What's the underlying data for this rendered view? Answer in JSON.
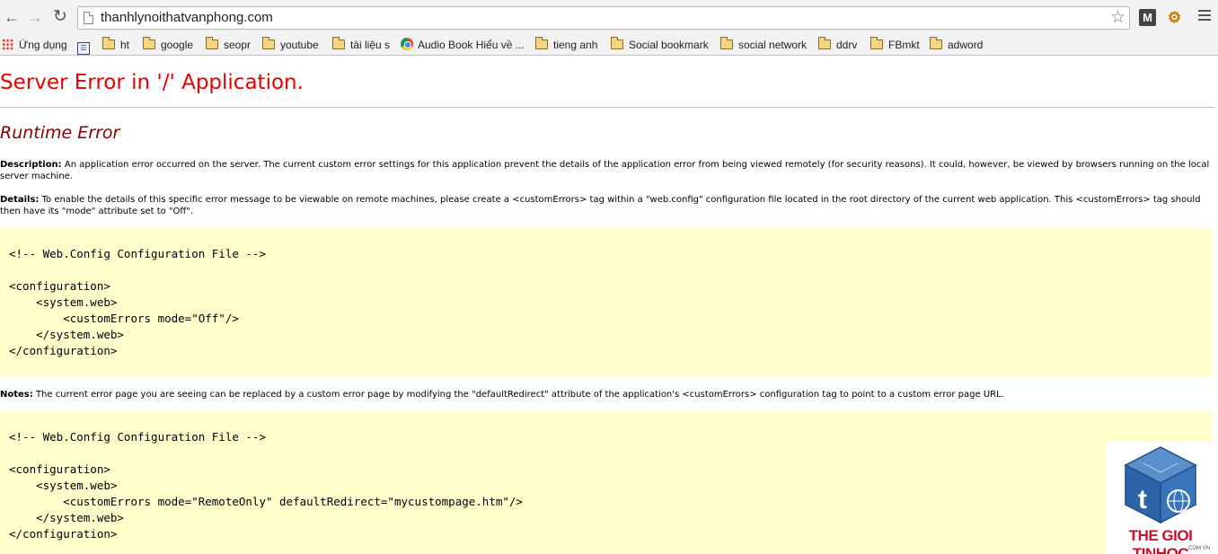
{
  "browser": {
    "url": "thanhlynoithatvanphong.com",
    "ext_m_label": "M"
  },
  "bookmarks": [
    {
      "label": "Ứng dụng",
      "icon": "apps-icon"
    },
    {
      "label": "",
      "icon": "page-icon"
    },
    {
      "label": "ht",
      "icon": "folder-icon"
    },
    {
      "label": "google",
      "icon": "folder-icon"
    },
    {
      "label": "seopr",
      "icon": "folder-icon"
    },
    {
      "label": "youtube",
      "icon": "folder-icon"
    },
    {
      "label": "tài liệu s",
      "icon": "folder-icon"
    },
    {
      "label": "Audio Book Hiểu về ...",
      "icon": "chrome-icon"
    },
    {
      "label": "tieng anh",
      "icon": "folder-icon"
    },
    {
      "label": "Social bookmark",
      "icon": "folder-icon"
    },
    {
      "label": "social network",
      "icon": "folder-icon"
    },
    {
      "label": "ddrv",
      "icon": "folder-icon"
    },
    {
      "label": "FBmkt",
      "icon": "folder-icon"
    },
    {
      "label": "adword",
      "icon": "folder-icon"
    }
  ],
  "page": {
    "title": "Server Error in '/' Application.",
    "subtitle": "Runtime Error",
    "description_label": "Description:",
    "description_text": "An application error occurred on the server. The current custom error settings for this application prevent the details of the application error from being viewed remotely (for security reasons). It could, however, be viewed by browsers running on the local server machine.",
    "details_label": "Details:",
    "details_text": "To enable the details of this specific error message to be viewable on remote machines, please create a <customErrors> tag within a \"web.config\" configuration file located in the root directory of the current web application. This <customErrors> tag should then have its \"mode\" attribute set to \"Off\".",
    "code1": [
      "<!-- Web.Config Configuration File -->",
      "",
      "<configuration>",
      "    <system.web>",
      "        <customErrors mode=\"Off\"/>",
      "    </system.web>",
      "</configuration>"
    ],
    "notes_label": "Notes:",
    "notes_text": "The current error page you are seeing can be replaced by a custom error page by modifying the \"defaultRedirect\" attribute of the application's <customErrors> configuration tag to point to a custom error page URL.",
    "code2": [
      "<!-- Web.Config Configuration File -->",
      "",
      "<configuration>",
      "    <system.web>",
      "        <customErrors mode=\"RemoteOnly\" defaultRedirect=\"mycustompage.htm\"/>",
      "    </system.web>",
      "</configuration>"
    ]
  },
  "watermark": {
    "brand": "THE GIOI TINHOC",
    "sub": ".COM.VN"
  },
  "colors": {
    "error_red": "#e00000",
    "runtime_maroon": "#800000",
    "code_bg": "#ffffcc"
  }
}
